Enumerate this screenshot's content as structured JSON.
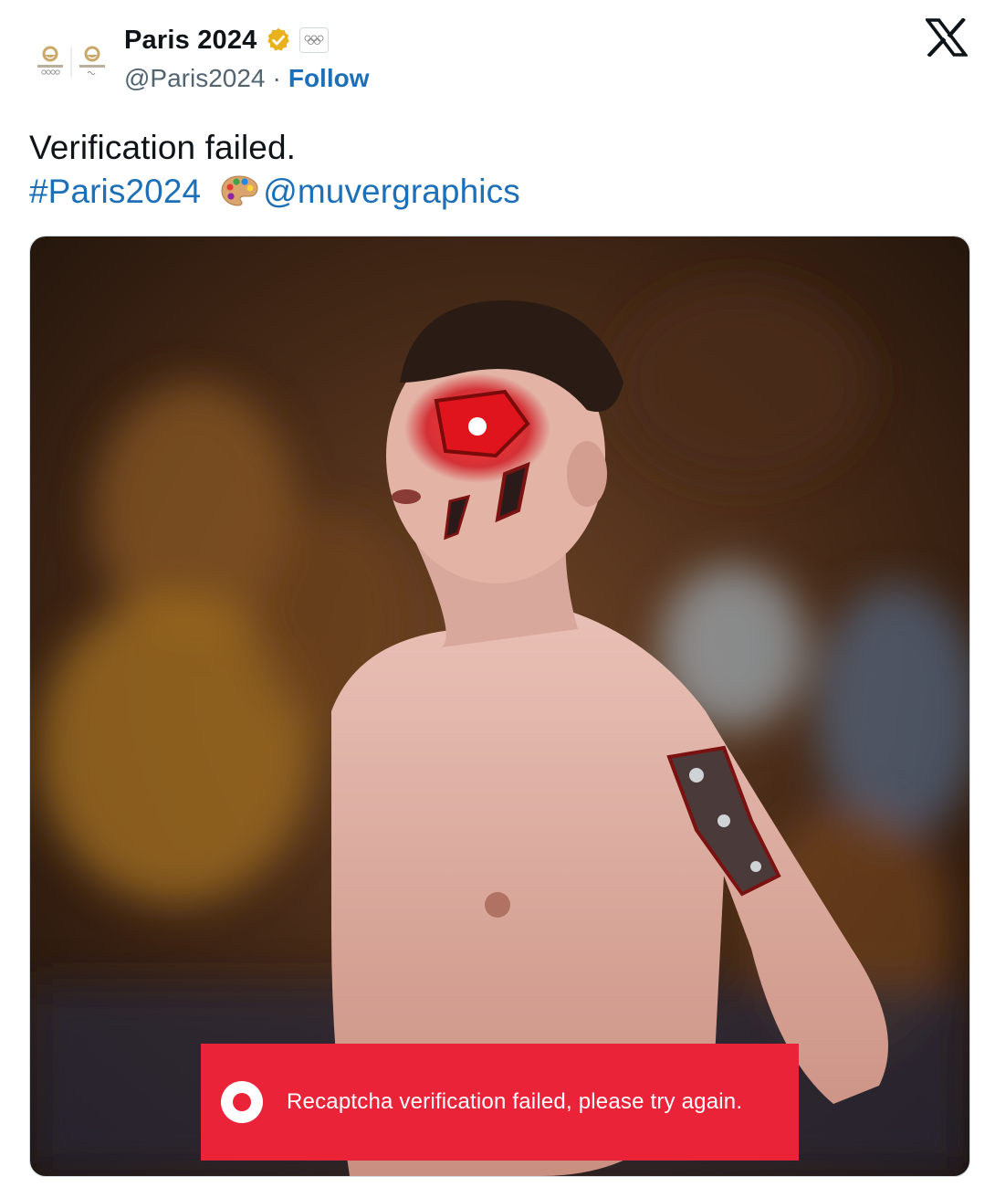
{
  "account": {
    "display_name": "Paris 2024",
    "handle": "@Paris2024",
    "separator": "·",
    "follow_label": "Follow",
    "verified_color": "#e8b21c"
  },
  "tweet": {
    "line1": "Verification failed.",
    "hashtag": "#Paris2024",
    "mention": "@muvergraphics"
  },
  "media": {
    "toast_message": "Recaptcha verification failed, please try again.",
    "toast_color": "#ea2339"
  },
  "icons": {
    "avatar": "paris-2024-emblems-icon",
    "verified": "gold-verified-badge-icon",
    "affiliate": "olympic-rings-icon",
    "brand": "x-logo-icon",
    "emoji": "artist-palette-icon",
    "toast": "record-circle-icon"
  }
}
